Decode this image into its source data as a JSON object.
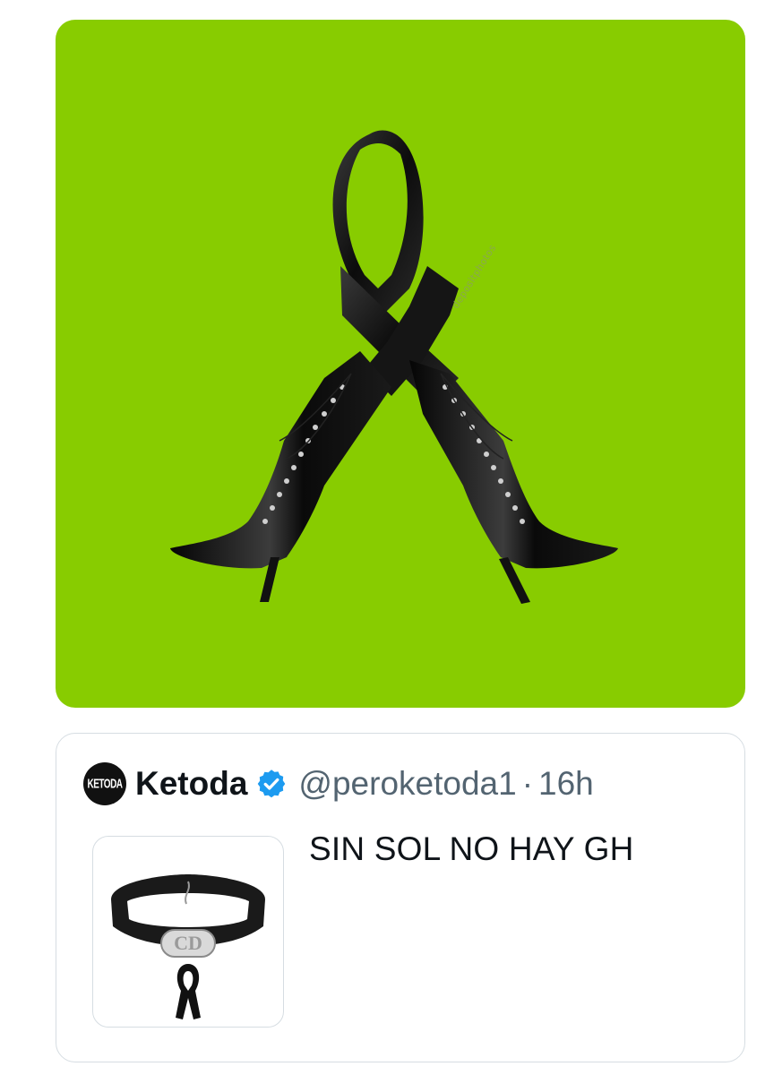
{
  "media": {
    "background_color": "#88cc00",
    "ribbon_color": "#111111",
    "watermark_text": "depositphotos",
    "icon": "black-ribbon-with-boots"
  },
  "quote": {
    "avatar_text": "KETODA",
    "author_name": "Ketoda",
    "verified_color": "#1d9bf0",
    "handle": "@peroketoda1",
    "separator": "·",
    "time": "16h",
    "text": "SIN SOL NO HAY GH",
    "thumbnail_icon": "choker-with-black-ribbon",
    "thumbnail_brand": "CD"
  }
}
